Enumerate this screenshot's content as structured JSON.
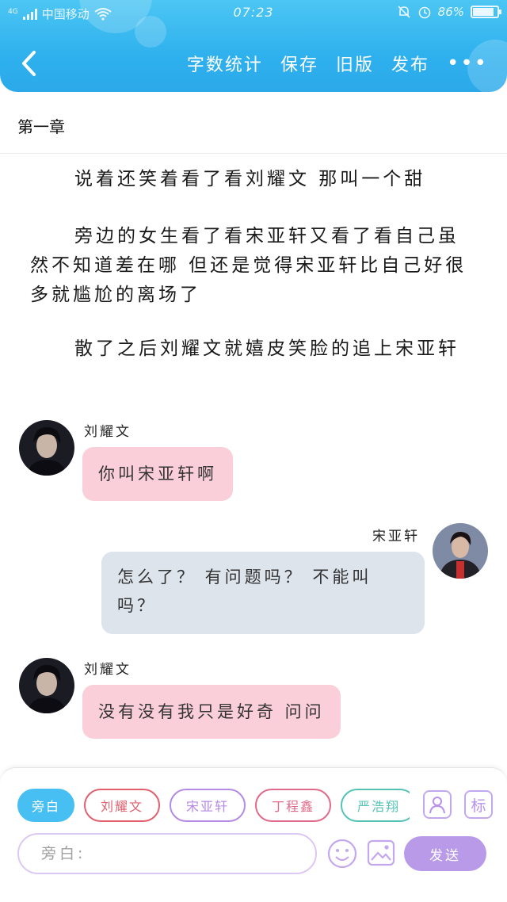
{
  "status_bar": {
    "network": "4G",
    "carrier": "中国移动",
    "time": "07:23",
    "battery": "86%",
    "battery_level": 0.86
  },
  "header": {
    "back_icon": "chevron-left-icon",
    "actions": [
      "字数统计",
      "保存",
      "旧版",
      "发布"
    ],
    "more_label": "•••"
  },
  "chapter": {
    "title": "第一章"
  },
  "paragraphs": [
    "说着还笑着看了看刘耀文 那叫一个甜",
    "旁边的女生看了看宋亚轩又看了看自己虽然不知道差在哪 但还是觉得宋亚轩比自己好很多就尴尬的离场了",
    "散了之后刘耀文就嬉皮笑脸的追上宋亚轩"
  ],
  "messages": [
    {
      "speaker": "刘耀文",
      "text": "你叫宋亚轩啊"
    },
    {
      "speaker": "宋亚轩",
      "text": "怎么了？ 有问题吗？ 不能叫吗？"
    },
    {
      "speaker": "刘耀文",
      "text": "没有没有我只是好奇 问问"
    }
  ],
  "composer": {
    "roles": [
      {
        "label": "旁白",
        "color": "#48bff3"
      },
      {
        "label": "刘耀文",
        "color": "#e0606e"
      },
      {
        "label": "宋亚轩",
        "color": "#b48ae4"
      },
      {
        "label": "丁程鑫",
        "color": "#e06a8a"
      },
      {
        "label": "严浩翔",
        "color": "#56c2b5"
      }
    ],
    "tag_icon_label": "标",
    "placeholder": "旁白:",
    "send_label": "发送"
  },
  "colors": {
    "header": "#2fb1ee",
    "bubble_left": "#fbcfd9",
    "bubble_right": "#dde4ec",
    "send": "#b89ae9"
  }
}
